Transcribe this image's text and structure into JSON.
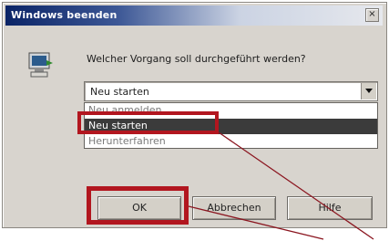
{
  "dialog": {
    "title": "Windows beenden",
    "close_glyph": "×",
    "question": "Welcher Vorgang soll durchgeführt werden?"
  },
  "combo": {
    "value": "Neu starten"
  },
  "dropdown": {
    "items": [
      "Neu anmelden",
      "Neu starten",
      "Herunterfahren"
    ],
    "selected_index": 1
  },
  "buttons": {
    "ok": "OK",
    "cancel": "Abbrechen",
    "help": "Hilfe"
  },
  "colors": {
    "highlight": "#b2161f",
    "annotation_line": "#8b1620"
  },
  "icons": {
    "app": "computer-icon",
    "combo": "chevron-down-icon",
    "close": "close-icon"
  }
}
